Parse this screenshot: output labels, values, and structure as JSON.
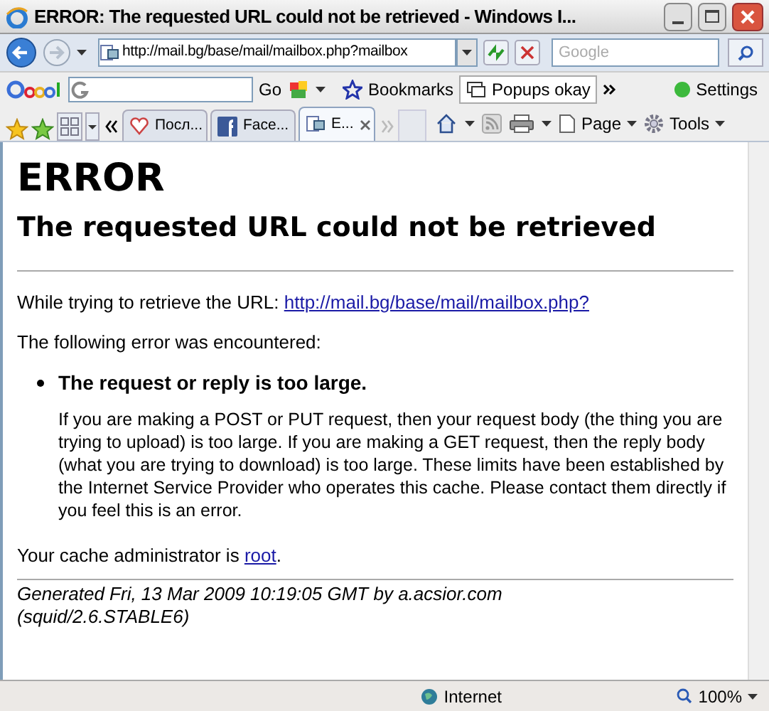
{
  "window": {
    "title": "ERROR: The requested URL could not be retrieved - Windows I..."
  },
  "address_bar": {
    "url": "http://mail.bg/base/mail/mailbox.php?mailbox"
  },
  "search": {
    "placeholder": "Google"
  },
  "google_toolbar": {
    "go": "Go",
    "bookmarks": "Bookmarks",
    "popups": "Popups okay",
    "settings": "Settings"
  },
  "tabs": [
    {
      "label": "Посл...",
      "kind": "heart",
      "selected": false
    },
    {
      "label": "Face...",
      "kind": "facebook",
      "selected": false
    },
    {
      "label": "E...",
      "kind": "page",
      "selected": true
    }
  ],
  "command_bar": {
    "page": "Page",
    "tools": "Tools"
  },
  "page": {
    "heading": "ERROR",
    "subheading": "The requested URL could not be retrieved",
    "url_intro": "While trying to retrieve the URL: ",
    "url_link": "http://mail.bg/base/mail/mailbox.php?",
    "error_intro": "The following error was encountered:",
    "error_item": "The request or reply is too large.",
    "error_detail": "If you are making a POST or PUT request, then your request body (the thing you are trying to upload) is too large. If you are making a GET request, then the reply body (what you are trying to download) is too large. These limits have been established by the Internet Service Provider who operates this cache. Please contact them directly if you feel this is an error.",
    "admin_intro": "Your cache administrator is ",
    "admin_link": "root",
    "admin_end": ".",
    "footer": [
      "Generated Fri, 13 Mar 2009 10:19:05 GMT by a.acsior.com",
      "(squid/2.6.STABLE6)"
    ]
  },
  "status_bar": {
    "zone": "Internet",
    "zoom": "100%"
  }
}
